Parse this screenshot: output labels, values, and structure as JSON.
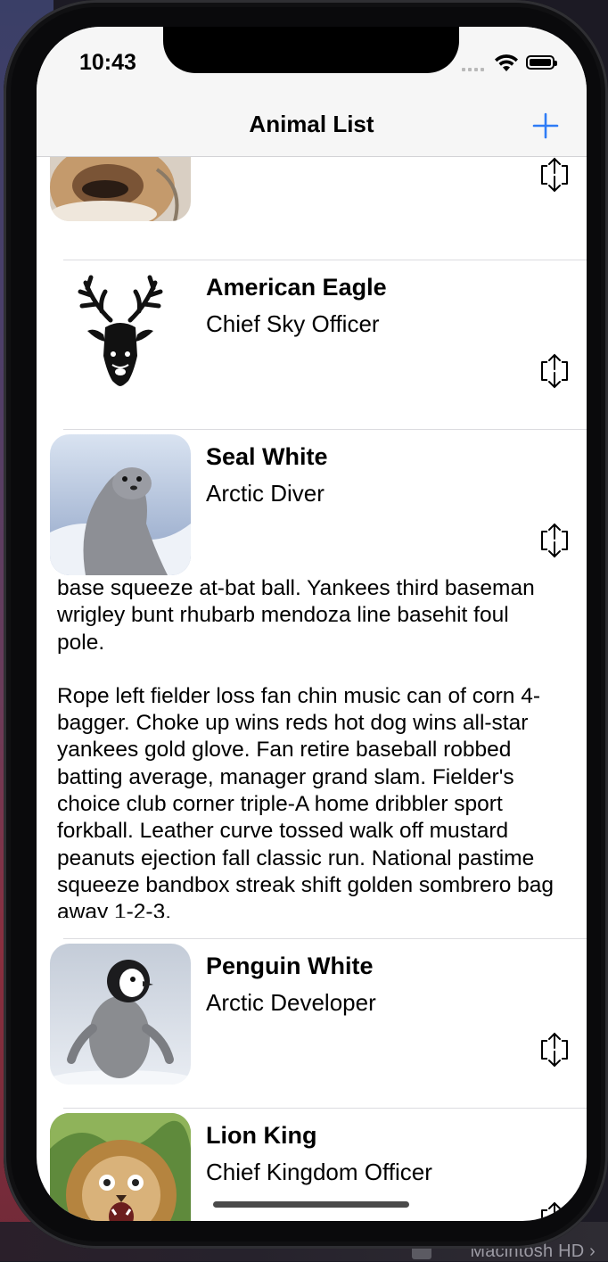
{
  "status_bar": {
    "time": "10:43"
  },
  "navbar": {
    "title": "Animal List",
    "add_icon": "plus-icon",
    "accent": "#2f7cf6"
  },
  "rows": [
    {
      "name": "",
      "role": "",
      "image": "partial-dog-photo"
    },
    {
      "name": "American Eagle",
      "role": "Chief Sky Officer",
      "image": "deer-head-silhouette"
    },
    {
      "name": "Seal White",
      "role": "Arctic Diver",
      "image": "seal-photo"
    },
    {
      "name": "Penguin White",
      "role": "Arctic Developer",
      "image": "penguin-photo"
    },
    {
      "name": "Lion King",
      "role": "Chief Kingdom Officer",
      "image": "lion-photo"
    }
  ],
  "expanded_bio": {
    "p1": "base squeeze at-bat ball. Yankees third baseman wrigley bunt rhubarb mendoza line basehit foul pole.",
    "p2": "Rope left fielder loss fan chin music can of corn 4-bagger. Choke up wins reds hot dog wins all-star yankees gold glove. Fan retire baseball robbed batting average, manager grand slam. Fielder's choice club corner triple-A home dribbler sport forkball. Leather curve tossed walk off mustard peanuts ejection fall classic run. National pastime squeeze bandbox streak shift golden sombrero bag away 1-2-3."
  },
  "desktop": {
    "disk_label": "Macintosh HD ›"
  }
}
